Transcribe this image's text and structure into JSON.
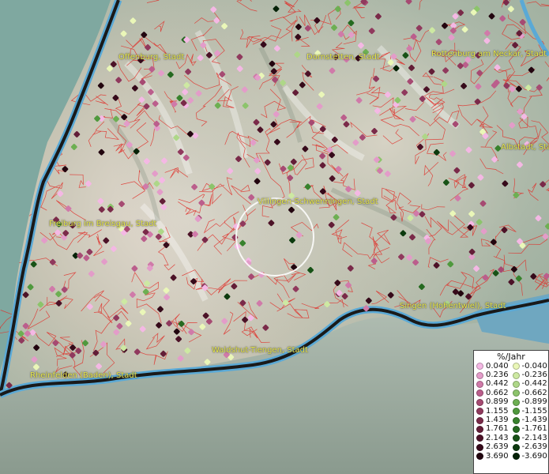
{
  "map": {
    "cities": [
      {
        "name": "Offenburg, Stadt",
        "id": "offenburg"
      },
      {
        "name": "Dornstetten, Stadt",
        "id": "dornstetten"
      },
      {
        "name": "Rottenburg am Neckar, Stadt",
        "id": "rottenburg"
      },
      {
        "name": "Albstadt, Stadt",
        "id": "albstadt"
      },
      {
        "name": "Villingen-Schwenningen, Stadt",
        "id": "villingen"
      },
      {
        "name": "Freiburg im Breisgau, Stadt",
        "id": "freiburg"
      },
      {
        "name": "Singen (Hohentwiel), Stadt",
        "id": "singen"
      },
      {
        "name": "Waldshut-Tiengen, Stadt",
        "id": "waldshut"
      },
      {
        "name": "Rheinfelden (Baden), Stadt",
        "id": "rheinfelden"
      }
    ],
    "colors": {
      "water": "#5aa9d6",
      "boundary": "#e0302a",
      "border": "#1a1a1a",
      "label": "#e8e84a"
    }
  },
  "legend": {
    "title": "%/Jahr",
    "positive": [
      {
        "value": "0.040",
        "color": "#f4b8e4"
      },
      {
        "value": "0.236",
        "color": "#e39cc9"
      },
      {
        "value": "0.442",
        "color": "#d07aa9"
      },
      {
        "value": "0.662",
        "color": "#bb5e8c"
      },
      {
        "value": "0.899",
        "color": "#a64a72"
      },
      {
        "value": "1.155",
        "color": "#90395d"
      },
      {
        "value": "1.439",
        "color": "#7a2a49"
      },
      {
        "value": "1.761",
        "color": "#631d37"
      },
      {
        "value": "2.143",
        "color": "#4c1227"
      },
      {
        "value": "2.639",
        "color": "#360a1a"
      },
      {
        "value": "3.690",
        "color": "#22050f"
      }
    ],
    "negative": [
      {
        "value": "-0.040",
        "color": "#eaf7b8"
      },
      {
        "value": "-0.236",
        "color": "#cde9a2"
      },
      {
        "value": "-0.442",
        "color": "#aed788"
      },
      {
        "value": "-0.662",
        "color": "#8cc46b"
      },
      {
        "value": "-0.899",
        "color": "#6daf52"
      },
      {
        "value": "-1.155",
        "color": "#4f993d"
      },
      {
        "value": "-1.439",
        "color": "#38822d"
      },
      {
        "value": "-1.761",
        "color": "#256a20"
      },
      {
        "value": "-2.143",
        "color": "#175216"
      },
      {
        "value": "-2.639",
        "color": "#0c3a0e"
      },
      {
        "value": "-3.690",
        "color": "#052207"
      }
    ]
  }
}
